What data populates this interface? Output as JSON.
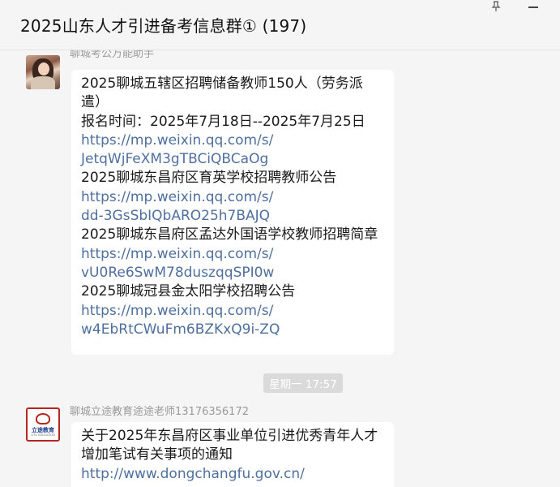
{
  "window": {
    "title": "2025山东人才引进备考信息群① (197)"
  },
  "messages": [
    {
      "sender": "聊城考公万能助手",
      "lines": [
        {
          "text": "2025聊城五辖区招聘储备教师150人（劳务派",
          "type": "text"
        },
        {
          "text": "遣）",
          "type": "text"
        },
        {
          "text": "报名时间：2025年7月18日--2025年7月25日",
          "type": "text"
        },
        {
          "text": "https://mp.weixin.qq.com/s/",
          "type": "link"
        },
        {
          "text": "JetqWjFeXM3gTBCiQBCaOg",
          "type": "link"
        },
        {
          "text": "2025聊城东昌府区育英学校招聘教师公告",
          "type": "text"
        },
        {
          "text": "https://mp.weixin.qq.com/s/",
          "type": "link"
        },
        {
          "text": "dd-3GsSbIQbARO25h7BAJQ",
          "type": "link"
        },
        {
          "text": "2025聊城东昌府区孟达外国语学校教师招聘简章",
          "type": "text"
        },
        {
          "text": "https://mp.weixin.qq.com/s/",
          "type": "link"
        },
        {
          "text": "vU0Re6SwM78duszqqSPI0w",
          "type": "link"
        },
        {
          "text": "2025聊城冠县金太阳学校招聘公告",
          "type": "text"
        },
        {
          "text": "https://mp.weixin.qq.com/s/",
          "type": "link"
        },
        {
          "text": "w4EbRtCWuFm6BZKxQ9i-ZQ",
          "type": "link"
        }
      ]
    },
    {
      "sender": "聊城立途教育途途老师13176356172",
      "avatar_text": "立途教育",
      "avatar_subtext": "LITU EDUCATION",
      "lines": [
        {
          "text": "关于2025年东昌府区事业单位引进优秀青年人才",
          "type": "text"
        },
        {
          "text": "增加笔试有关事项的通知",
          "type": "text"
        },
        {
          "text": "http://www.dongchangfu.gov.cn/",
          "type": "link"
        }
      ]
    }
  ],
  "timestamp": "星期一 17:57",
  "colors": {
    "background": "#f5f5f5",
    "bubble": "#ffffff",
    "link": "#4f6f9e",
    "timestamp_bg": "#dadada",
    "brand_red": "#b7251f"
  }
}
